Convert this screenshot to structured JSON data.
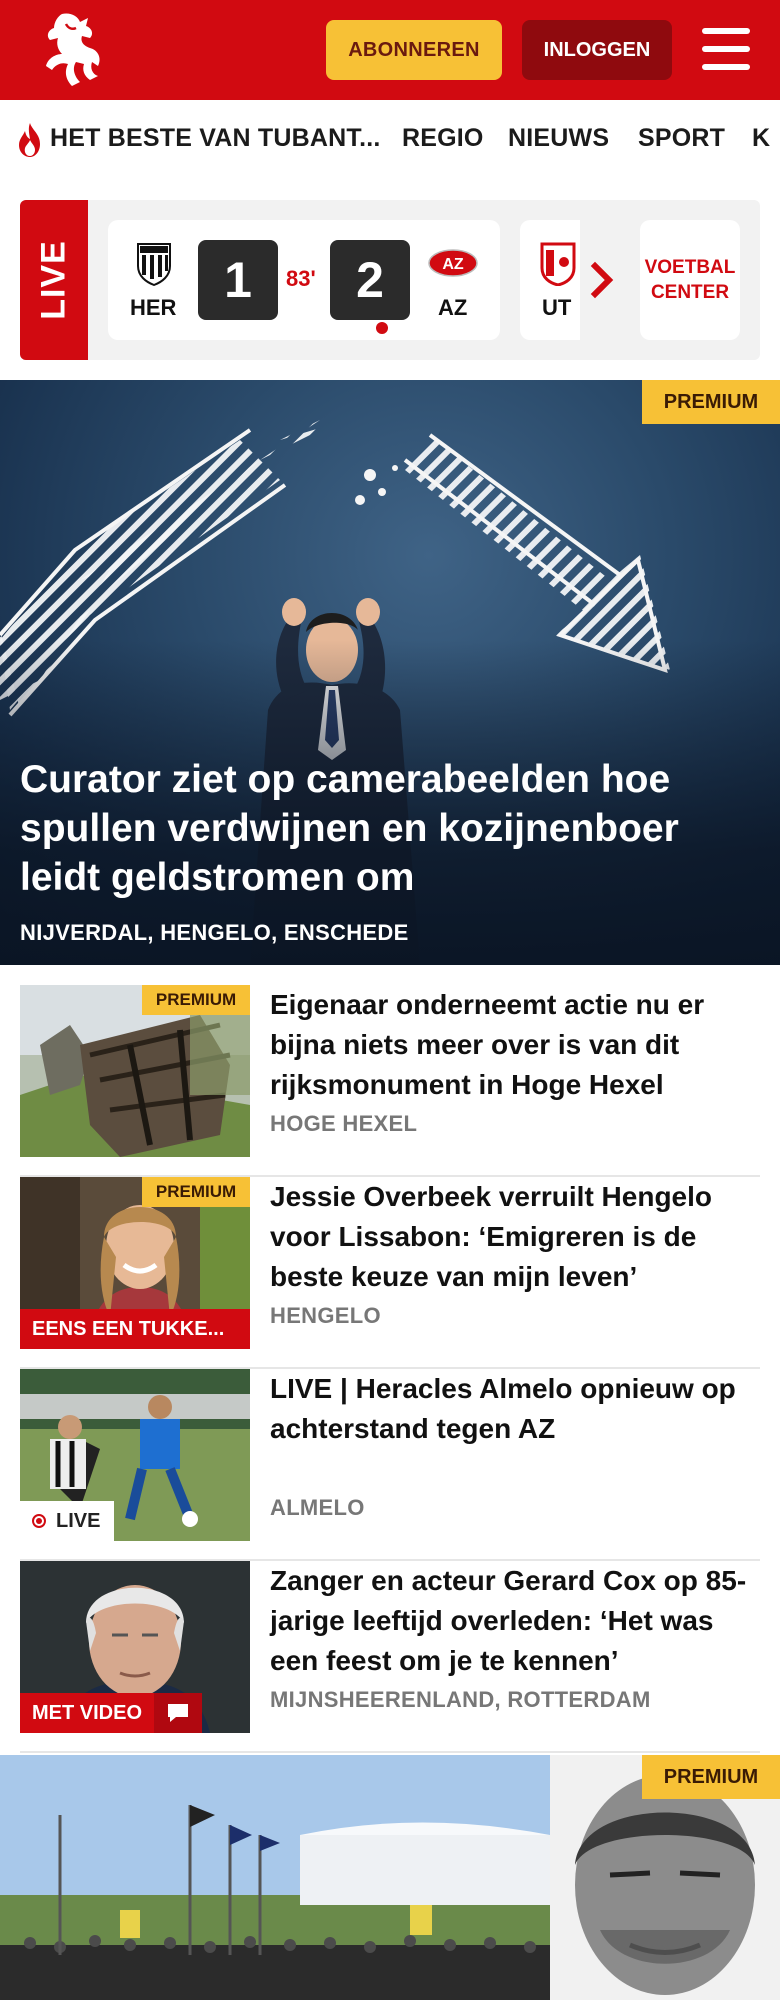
{
  "header": {
    "subscribe_label": "ABONNEREN",
    "login_label": "INLOGGEN",
    "colors": {
      "brand_red": "#d10a11",
      "premium_yellow": "#f7c136"
    }
  },
  "nav": {
    "items": [
      "HET BESTE VAN TUBANT...",
      "REGIO",
      "NIEUWS",
      "SPORT",
      "K"
    ]
  },
  "live": {
    "label": "LIVE",
    "match": {
      "home_abbr": "HER",
      "home_score": "1",
      "minute": "83'",
      "away_score": "2",
      "away_abbr": "AZ"
    },
    "next_match_abbr": "UT",
    "center_label_1": "VOETBAL",
    "center_label_2": "CENTER"
  },
  "hero": {
    "premium_label": "PREMIUM",
    "title": "Curator ziet op camerabeelden hoe spullen verdwijnen en kozijnenboer leidt geldstromen om",
    "location": "NIJVERDAL, HENGELO, ENSCHEDE"
  },
  "articles": [
    {
      "premium_label": "PREMIUM",
      "title": "Eigenaar onderneemt actie nu er bijna niets meer over is van dit rijksmonument in Hoge Hexel",
      "location": "HOGE HEXEL"
    },
    {
      "premium_label": "PREMIUM",
      "badge": "EENS EEN TUKKE...",
      "title": "Jessie Overbeek verruilt Hengelo voor Lissabon: ‘Emigreren is de beste keuze van mijn leven’",
      "location": "HENGELO"
    },
    {
      "badge": "LIVE",
      "title": "LIVE | Heracles Almelo opnieuw op achterstand tegen AZ",
      "location": "ALMELO"
    },
    {
      "badge": "MET VIDEO",
      "title": "Zanger en acteur Gerard Cox op 85-jarige leeftijd overleden: ‘Het was een feest om je te kennen’",
      "location": "MIJNSHEERENLAND, ROTTERDAM"
    }
  ],
  "promo": {
    "premium_label": "PREMIUM"
  }
}
